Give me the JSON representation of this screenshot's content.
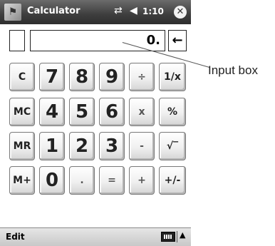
{
  "titlebar": {
    "logo": "windows-flag-icon",
    "title": "Calculator",
    "connectivity_icon": "connectivity-icon",
    "volume_icon": "volume-icon",
    "time": "1:10",
    "close_symbol": "✕"
  },
  "display": {
    "memory_indicator": "",
    "value": "0.",
    "backspace_symbol": "←"
  },
  "callout": {
    "label": "Input box"
  },
  "keys": {
    "row1": [
      "C",
      "7",
      "8",
      "9",
      "÷",
      "1/x"
    ],
    "row2": [
      "MC",
      "4",
      "5",
      "6",
      "x",
      "%"
    ],
    "row3": [
      "MR",
      "1",
      "2",
      "3",
      "-",
      "√‾"
    ],
    "row4": [
      "M+",
      "0",
      ".",
      "=",
      "+",
      "+/-"
    ]
  },
  "commandbar": {
    "menu": "Edit",
    "keyboard_icon": "keyboard-icon",
    "arrow": "▲"
  }
}
